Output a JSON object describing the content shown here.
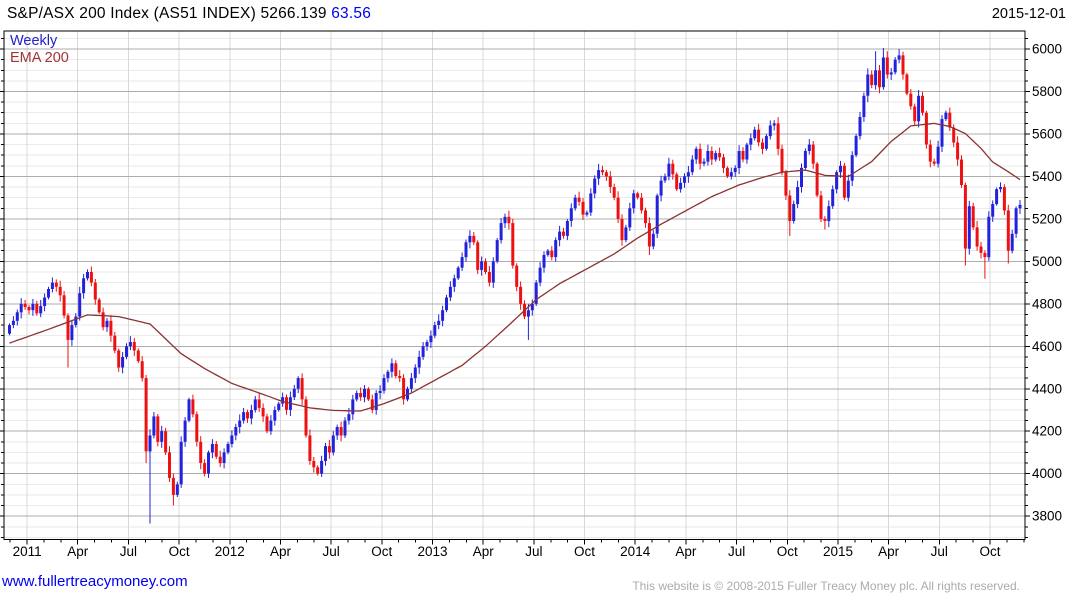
{
  "header": {
    "title": "S&P/ASX 200 Index (AS51 INDEX)",
    "last_price": "5266.139",
    "change": "63.56",
    "date": "2015-12-01"
  },
  "legend": {
    "timeframe": "Weekly",
    "overlay": "EMA 200"
  },
  "footer": {
    "website": "www.fullertreacymoney.com",
    "copyright": "This website is © 2008-2015 Fuller Treacy Money plc. All rights reserved."
  },
  "colors": {
    "up_candle": "#2222DD",
    "down_candle": "#EE1111",
    "ema_line": "#8B3232",
    "grid_major": "#ADADAD",
    "grid_minor": "#EAEAEA",
    "grid_vertical": "#D8D8D8",
    "axis_border": "#000000",
    "change_text": "#0000EE",
    "link_text": "#0000EE",
    "copyright_text": "#ABABAB"
  },
  "chart_data": {
    "type": "candlestick",
    "title": "S&P/ASX 200 Index (AS51 INDEX) 5266.139 63.56",
    "timeframe": "Weekly",
    "overlay": "EMA 200",
    "as_of_date": "2015-12-01",
    "last_close": 5266.139,
    "change": 63.56,
    "ylim": [
      3690,
      6085
    ],
    "y_major_ticks": [
      3800,
      4000,
      4200,
      4400,
      4600,
      4800,
      5000,
      5200,
      5400,
      5600,
      5800,
      6000
    ],
    "y_minor_step": 50,
    "x_tick_labels": [
      "2011",
      "Apr",
      "Jul",
      "Oct",
      "2012",
      "Apr",
      "Jul",
      "Oct",
      "2013",
      "Apr",
      "Jul",
      "Oct",
      "2014",
      "Apr",
      "Jul",
      "Oct",
      "2015",
      "Apr",
      "Jul",
      "Oct"
    ],
    "jan2011_week_index": 5,
    "weeks_per_month": 4.33,
    "first_open": 4660,
    "weekly_closes": [
      4700,
      4720,
      4760,
      4800,
      4785,
      4770,
      4800,
      4755,
      4790,
      4830,
      4870,
      4900,
      4880,
      4840,
      4745,
      4630,
      4700,
      4740,
      4850,
      4920,
      4950,
      4900,
      4820,
      4760,
      4690,
      4720,
      4650,
      4580,
      4500,
      4550,
      4600,
      4620,
      4580,
      4530,
      4450,
      4105,
      4180,
      4270,
      4150,
      4200,
      4100,
      3980,
      3900,
      3950,
      4150,
      4250,
      4350,
      4280,
      4150,
      4050,
      4000,
      4100,
      4140,
      4080,
      4050,
      4100,
      4140,
      4180,
      4220,
      4250,
      4290,
      4260,
      4300,
      4350,
      4310,
      4270,
      4200,
      4250,
      4300,
      4330,
      4360,
      4300,
      4360,
      4400,
      4450,
      4350,
      4180,
      4060,
      4030,
      4000,
      4060,
      4130,
      4100,
      4180,
      4220,
      4180,
      4250,
      4280,
      4350,
      4380,
      4360,
      4400,
      4350,
      4300,
      4380,
      4390,
      4450,
      4480,
      4520,
      4460,
      4450,
      4350,
      4400,
      4450,
      4500,
      4550,
      4600,
      4620,
      4650,
      4700,
      4720,
      4770,
      4830,
      4880,
      4920,
      4970,
      5020,
      5090,
      5120,
      5090,
      4960,
      5000,
      4950,
      4900,
      5000,
      5100,
      5180,
      5210,
      5180,
      4980,
      4880,
      4800,
      4740,
      4770,
      4800,
      4900,
      4970,
      5030,
      5050,
      5020,
      5100,
      5140,
      5120,
      5190,
      5250,
      5300,
      5280,
      5220,
      5230,
      5320,
      5390,
      5430,
      5420,
      5400,
      5350,
      5300,
      5200,
      5100,
      5160,
      5250,
      5320,
      5300,
      5240,
      5180,
      5070,
      5130,
      5310,
      5380,
      5400,
      5460,
      5410,
      5340,
      5370,
      5400,
      5420,
      5480,
      5530,
      5460,
      5470,
      5520,
      5480,
      5510,
      5490,
      5440,
      5400,
      5420,
      5440,
      5520,
      5480,
      5550,
      5580,
      5620,
      5560,
      5530,
      5590,
      5640,
      5650,
      5530,
      5420,
      5310,
      5190,
      5270,
      5350,
      5440,
      5520,
      5550,
      5460,
      5310,
      5200,
      5190,
      5260,
      5340,
      5420,
      5450,
      5300,
      5380,
      5500,
      5590,
      5680,
      5780,
      5880,
      5830,
      5900,
      5820,
      5960,
      5880,
      5890,
      5950,
      5970,
      5880,
      5790,
      5730,
      5660,
      5780,
      5700,
      5550,
      5470,
      5460,
      5540,
      5670,
      5700,
      5630,
      5560,
      5480,
      5360,
      5060,
      5260,
      5160,
      5070,
      5040,
      5020,
      5210,
      5270,
      5340,
      5350,
      5240,
      5050,
      5130,
      5250,
      5266
    ],
    "wick_overrides": {
      "15": {
        "low": 4500
      },
      "35": {
        "low": 4050
      },
      "36": {
        "low": 3765
      },
      "42": {
        "low": 3850
      },
      "80": {
        "low": 3985
      },
      "133": {
        "low": 4630
      },
      "164": {
        "low": 5030
      },
      "200": {
        "low": 5120
      },
      "209": {
        "low": 5150
      },
      "222": {
        "high": 5990
      },
      "224": {
        "high": 6005
      },
      "228": {
        "high": 6000
      },
      "245": {
        "low": 4980
      },
      "250": {
        "low": 4918
      },
      "256": {
        "low": 4990
      }
    },
    "ema200_anchors": [
      [
        0,
        4615
      ],
      [
        10,
        4680
      ],
      [
        20,
        4748
      ],
      [
        28,
        4740
      ],
      [
        36,
        4705
      ],
      [
        44,
        4565
      ],
      [
        50,
        4495
      ],
      [
        57,
        4425
      ],
      [
        64,
        4380
      ],
      [
        70,
        4340
      ],
      [
        77,
        4310
      ],
      [
        83,
        4298
      ],
      [
        90,
        4295
      ],
      [
        96,
        4330
      ],
      [
        103,
        4380
      ],
      [
        109,
        4440
      ],
      [
        116,
        4510
      ],
      [
        122,
        4600
      ],
      [
        128,
        4700
      ],
      [
        135,
        4820
      ],
      [
        141,
        4895
      ],
      [
        148,
        4965
      ],
      [
        155,
        5035
      ],
      [
        161,
        5110
      ],
      [
        167,
        5175
      ],
      [
        174,
        5245
      ],
      [
        180,
        5305
      ],
      [
        187,
        5360
      ],
      [
        193,
        5395
      ],
      [
        198,
        5420
      ],
      [
        204,
        5430
      ],
      [
        209,
        5405
      ],
      [
        215,
        5400
      ],
      [
        221,
        5470
      ],
      [
        226,
        5565
      ],
      [
        231,
        5638
      ],
      [
        237,
        5650
      ],
      [
        241,
        5635
      ],
      [
        245,
        5602
      ],
      [
        249,
        5532
      ],
      [
        252,
        5468
      ],
      [
        256,
        5422
      ],
      [
        259,
        5385
      ]
    ],
    "legend_position": "top-left",
    "grid": "major 200pt gray, minor 50pt light, vertical quarterly"
  }
}
